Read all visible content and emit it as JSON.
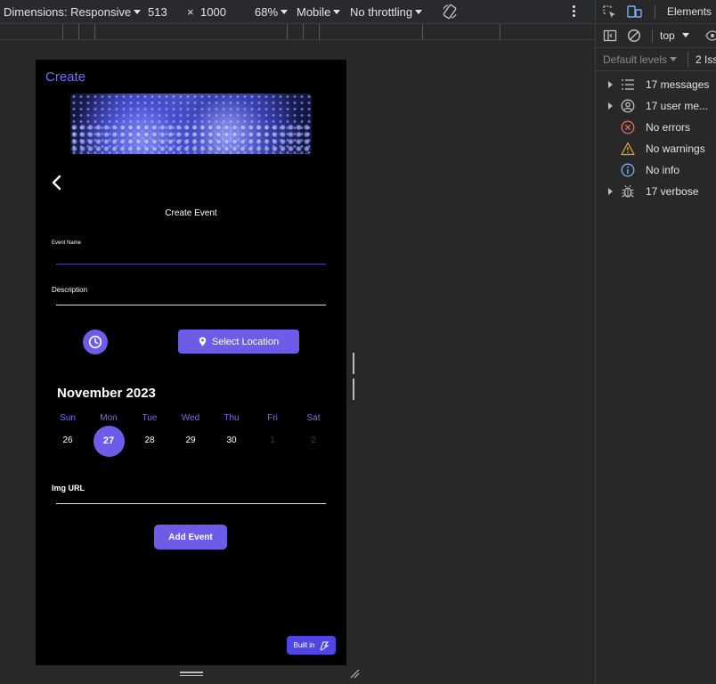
{
  "device_toolbar": {
    "dimensions_label": "Dimensions: Responsive",
    "width": "513",
    "times": "×",
    "height": "1000",
    "zoom": "68%",
    "device_mode": "Mobile",
    "throttling": "No throttling"
  },
  "app": {
    "title": "Create",
    "screen_title": "Create Event",
    "event_name_label": "Event Name",
    "description_label": "Description",
    "select_location_label": "Select Location",
    "img_url_label": "Img URL",
    "add_event_label": "Add Event",
    "built_in_label": "Built in",
    "accent": "#6c5ce7"
  },
  "calendar": {
    "month": "November 2023",
    "weekdays": [
      "Sun",
      "Mon",
      "Tue",
      "Wed",
      "Thu",
      "Fri",
      "Sat"
    ],
    "days": [
      {
        "label": "26",
        "state": "normal"
      },
      {
        "label": "27",
        "state": "selected"
      },
      {
        "label": "28",
        "state": "normal"
      },
      {
        "label": "29",
        "state": "normal"
      },
      {
        "label": "30",
        "state": "normal"
      },
      {
        "label": "1",
        "state": "muted"
      },
      {
        "label": "2",
        "state": "muted"
      }
    ]
  },
  "devtools": {
    "elements_tab": "Elements",
    "context": "top",
    "levels": "Default levels",
    "issues": "2 Iss",
    "messages": [
      {
        "label": "17 messages",
        "icon": "list-icon",
        "expandable": true
      },
      {
        "label": "17 user me...",
        "icon": "user-icon",
        "expandable": true
      },
      {
        "label": "No errors",
        "icon": "error-icon",
        "expandable": false
      },
      {
        "label": "No warnings",
        "icon": "warning-icon",
        "expandable": false
      },
      {
        "label": "No info",
        "icon": "info-icon",
        "expandable": false
      },
      {
        "label": "17 verbose",
        "icon": "bug-icon",
        "expandable": true
      }
    ]
  }
}
